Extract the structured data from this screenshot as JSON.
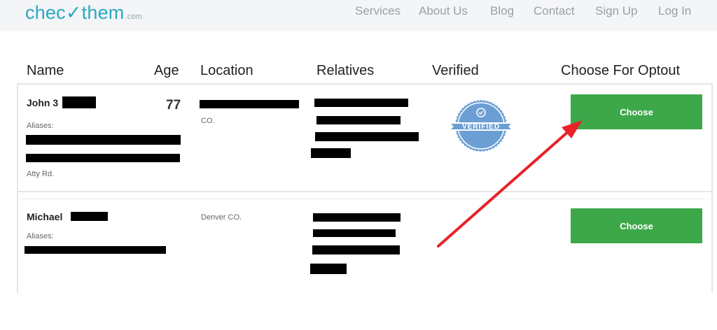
{
  "brand": {
    "name_start": "chec",
    "name_end": "them",
    "suffix": ".com"
  },
  "nav": [
    "Services",
    "About Us",
    "Blog",
    "Contact",
    "Sign Up",
    "Log In"
  ],
  "columns": [
    "Name",
    "Age",
    "Location",
    "Relatives",
    "Verified",
    "Choose For Optout"
  ],
  "rows": [
    {
      "name": "John 3",
      "age": "77",
      "location": "CO.",
      "aliases_label": "Aliases:",
      "address_end": "Atty Rd.",
      "button": "Choose",
      "verified_text": "VERIFIED"
    },
    {
      "name": "Michael",
      "location": "Denver CO.",
      "aliases_label": "Aliases:",
      "button": "Choose"
    }
  ],
  "colors": {
    "brand": "#2aa9c2",
    "button": "#3da84a",
    "badge": "#6b9fd4",
    "arrow": "#e8232a"
  },
  "icons": {
    "verified": "verified-seal-icon",
    "arrow": "red-arrow-annotation"
  }
}
